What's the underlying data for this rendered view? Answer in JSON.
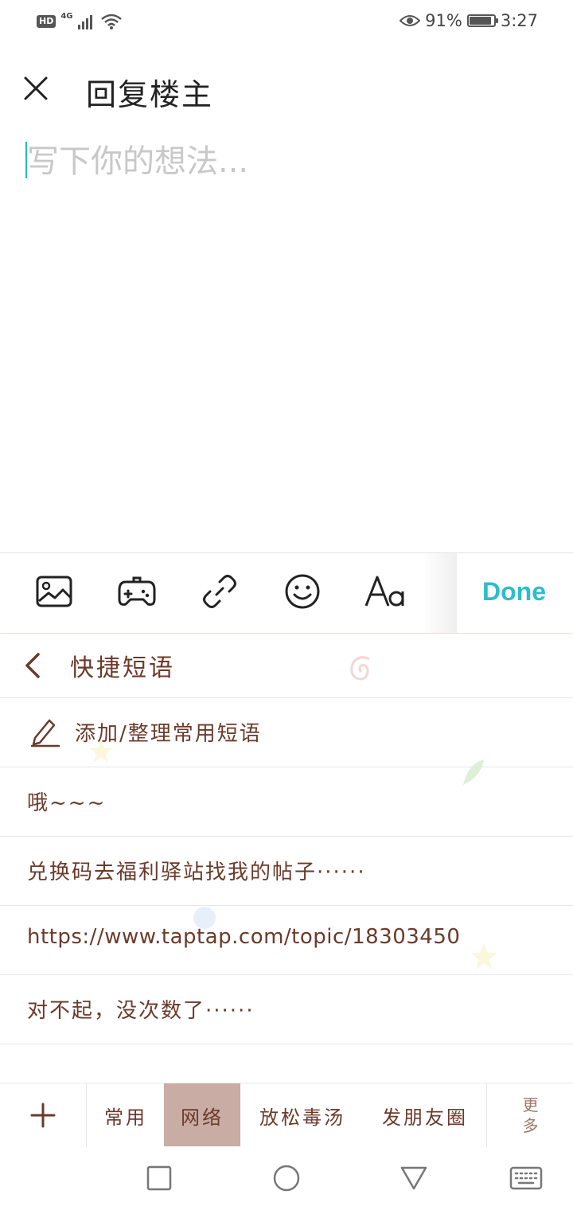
{
  "status_bar": {
    "hd": "HD",
    "network": "4G",
    "battery_percent": "91%",
    "battery_level": 0.91,
    "time": "3:27"
  },
  "header": {
    "title": "回复楼主"
  },
  "editor": {
    "placeholder": "写下你的想法...",
    "value": ""
  },
  "toolbar": {
    "icons": [
      "image-icon",
      "gamepad-icon",
      "link-icon",
      "emoji-icon",
      "font-icon"
    ],
    "done_label": "Done"
  },
  "quick_phrases": {
    "title": "快捷短语",
    "add_label": "添加/整理常用短语",
    "items": [
      "哦~~~",
      "兑换码去福利驿站找我的帖子······",
      "https://www.taptap.com/topic/18303450",
      "对不起，没次数了······"
    ]
  },
  "categories": {
    "tabs": [
      "常用",
      "网络",
      "放松毒汤",
      "发朋友圈"
    ],
    "active": "网络",
    "more_label_1": "更",
    "more_label_2": "多"
  },
  "colors": {
    "accent": "#2bbecb",
    "phrase_text": "#6b3a2a",
    "active_tab": "#c9aca4"
  }
}
